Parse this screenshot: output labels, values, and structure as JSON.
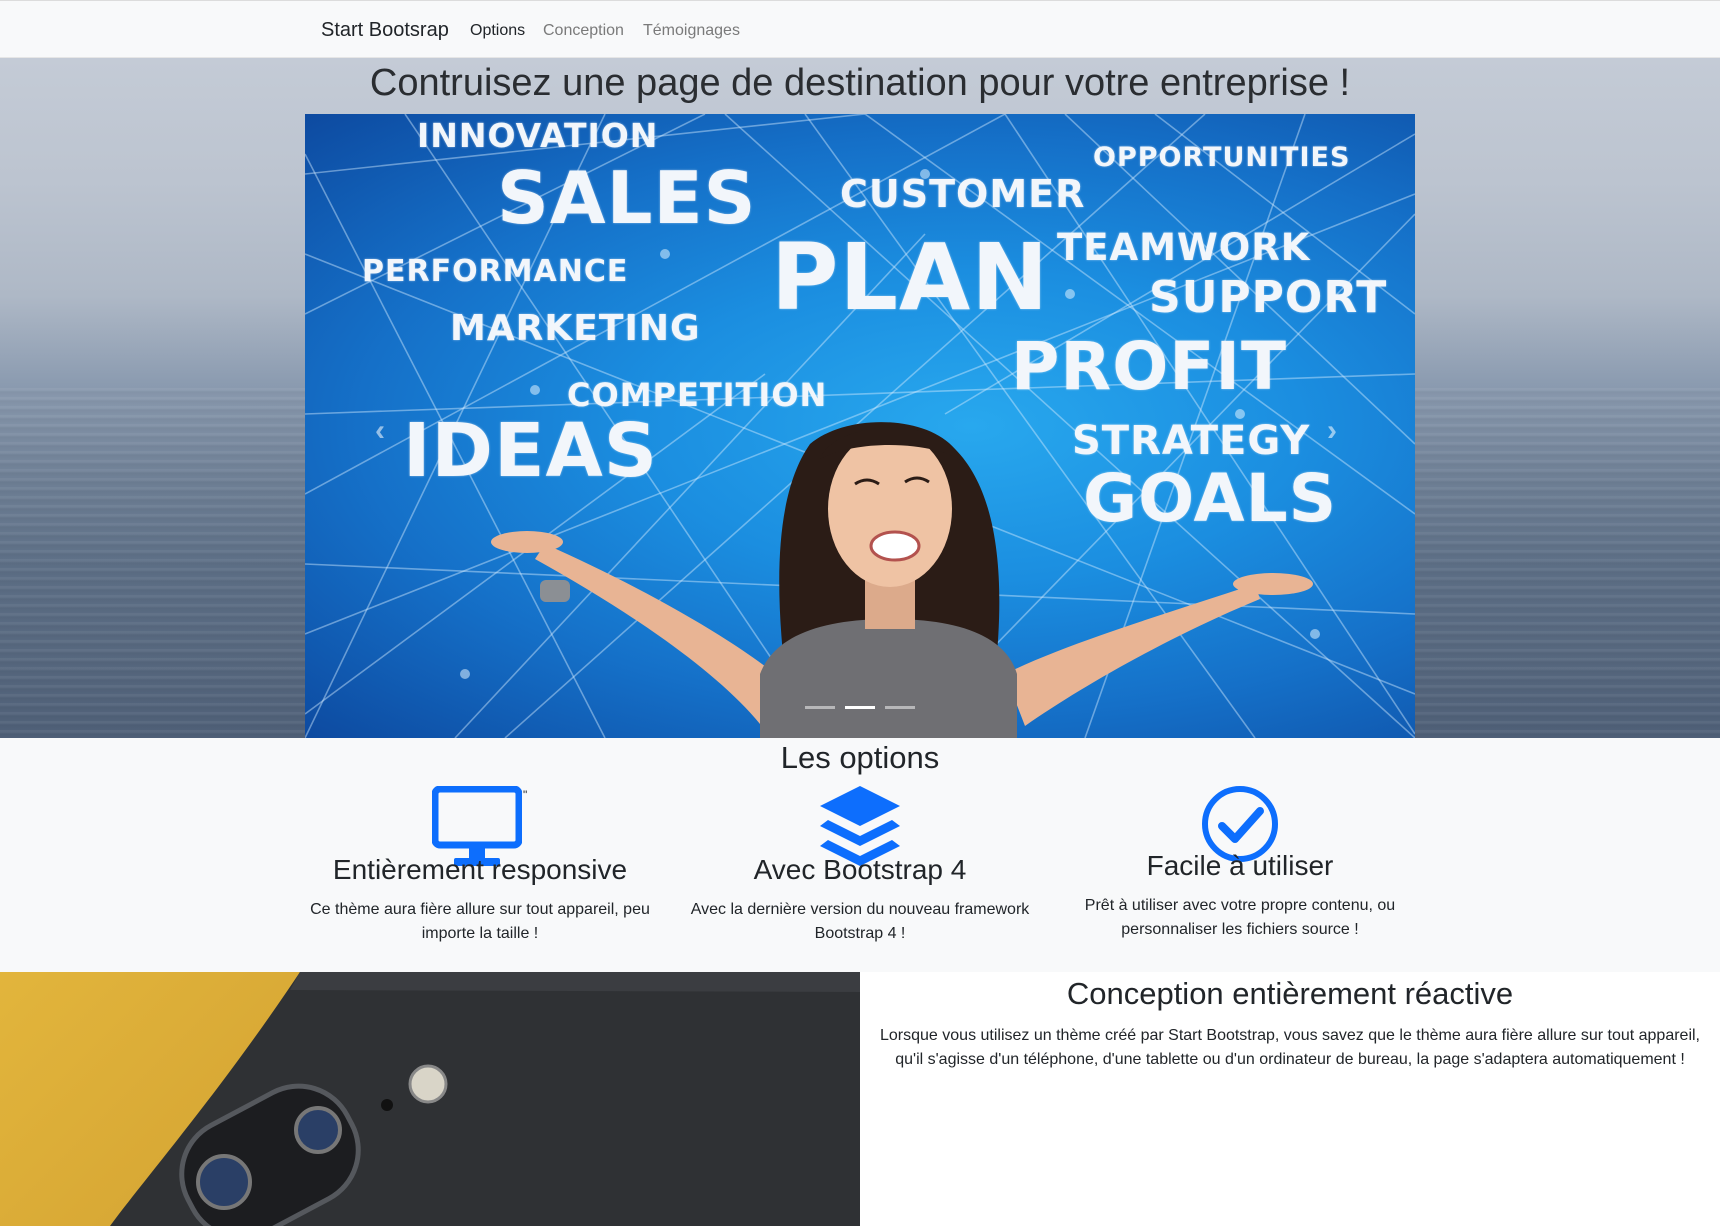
{
  "navbar": {
    "brand": "Start Bootsrap",
    "links": [
      {
        "label": "Options",
        "active": true
      },
      {
        "label": "Conception",
        "active": false
      },
      {
        "label": "Témoignages",
        "active": false
      }
    ]
  },
  "hero": {
    "title": "Contruisez une page de destination pour votre entreprise !",
    "carousel": {
      "words": [
        "INNOVATION",
        "SALES",
        "CUSTOMER",
        "OPPORTUNITIES",
        "PERFORMANCE",
        "PLAN",
        "TEAMWORK",
        "SUPPORT",
        "MARKETING",
        "PROFIT",
        "COMPETITION",
        "IDEAS",
        "STRATEGY",
        "GOALS"
      ],
      "prev_icon": "chevron-left-icon",
      "next_icon": "chevron-right-icon",
      "slides": 3,
      "active_slide": 2
    }
  },
  "options": {
    "title": "Les options",
    "features": [
      {
        "icon": "desktop-icon",
        "title": "Entièrement responsive",
        "text_line1": "Ce thème aura fière allure sur tout appareil, peu",
        "text_line2": "importe la taille !",
        "mark": "\""
      },
      {
        "icon": "layers-icon",
        "title": "Avec Bootstrap 4",
        "text_line1": "Avec la dernière version du nouveau framework",
        "text_line2": "Bootstrap 4 !"
      },
      {
        "icon": "check-circle-icon",
        "title": "Facile à utiliser",
        "text_line1": "Prêt à utiliser avec votre propre contenu, ou",
        "text_line2": "personnaliser les fichiers source !"
      }
    ],
    "accent_color": "#0d6efd"
  },
  "showcase": {
    "title": "Conception entièrement réactive",
    "text_line1": "Lorsque vous utilisez un thème créé par Start Bootstrap, vous savez que le thème aura fière allure sur tout appareil,",
    "text_line2": "qu'il s'agisse d'un téléphone, d'une tablette ou d'un ordinateur de bureau, la page s'adaptera automatiquement !"
  }
}
